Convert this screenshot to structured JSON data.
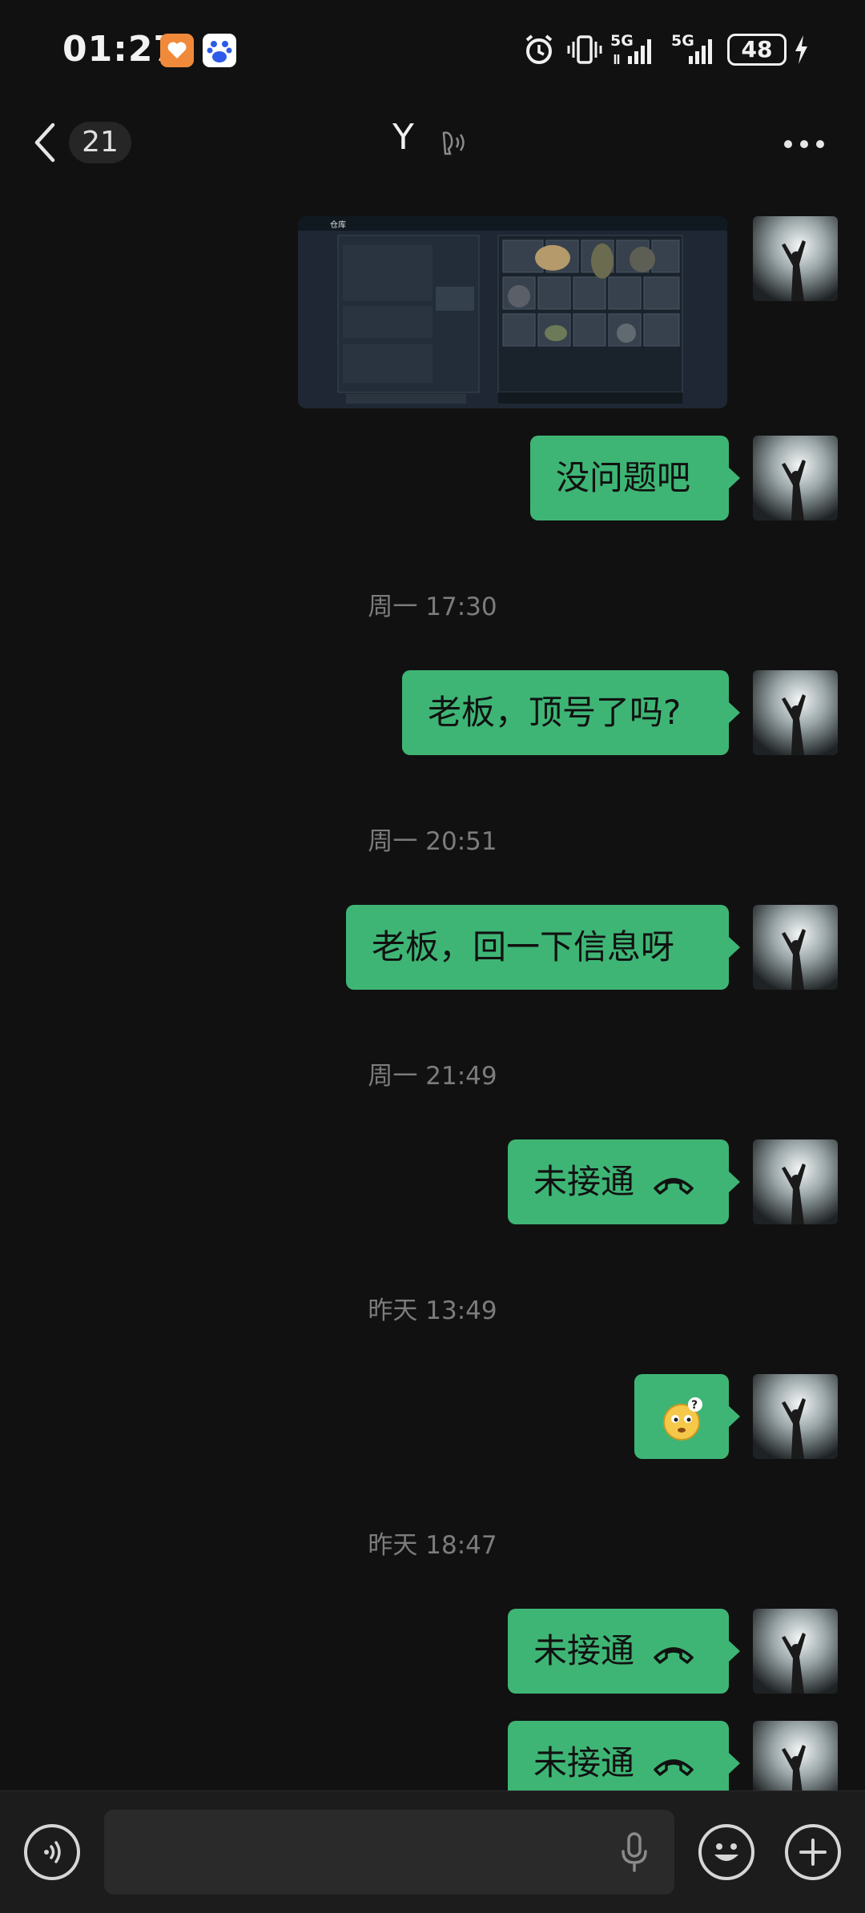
{
  "status_bar": {
    "time": "01:27",
    "battery": "48",
    "network_1": "5G",
    "network_2": "5G",
    "icons": [
      "health-app-icon",
      "baidu-app-icon",
      "alarm-icon",
      "vibrate-icon",
      "signal-icon",
      "charging-icon"
    ]
  },
  "nav": {
    "unread_count": "21",
    "title": "Y",
    "icons": [
      "back-chevron-icon",
      "voice-mode-icon",
      "more-icon"
    ]
  },
  "messages": [
    {
      "type": "image",
      "alt": "仓库"
    },
    {
      "type": "text",
      "text": "没问题吧"
    },
    {
      "type": "timestamp",
      "text": "周一 17:30"
    },
    {
      "type": "text",
      "text": "老板，顶号了吗?"
    },
    {
      "type": "timestamp",
      "text": "周一 20:51"
    },
    {
      "type": "text",
      "text": "老板，回一下信息呀"
    },
    {
      "type": "timestamp",
      "text": "周一 21:49"
    },
    {
      "type": "call",
      "text": "未接通"
    },
    {
      "type": "timestamp",
      "text": "昨天 13:49"
    },
    {
      "type": "sticker",
      "emoji": "🤔"
    },
    {
      "type": "timestamp",
      "text": "昨天 18:47"
    },
    {
      "type": "call",
      "text": "未接通"
    },
    {
      "type": "call",
      "text": "未接通"
    }
  ],
  "input": {
    "placeholder": "",
    "icons": [
      "voice-input-icon",
      "microphone-icon",
      "emoji-icon",
      "plus-icon"
    ]
  },
  "colors": {
    "bubble": "#3eb575",
    "background": "#111111",
    "timestamp": "#7c7c7c"
  }
}
